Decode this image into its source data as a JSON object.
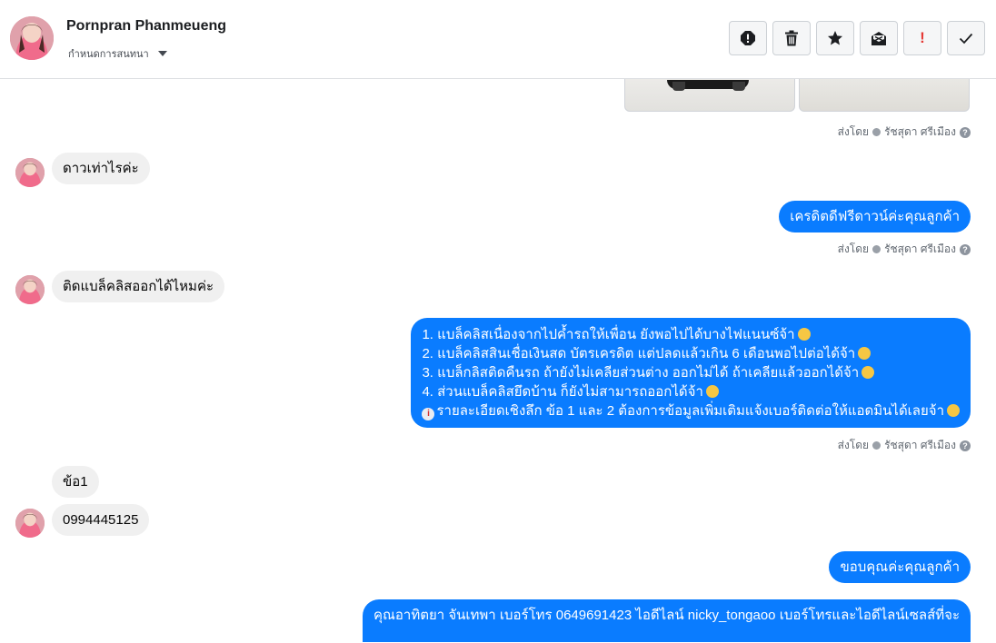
{
  "contact": {
    "name": "Pornpran Phanmeueng",
    "assign_label": "กำหนดการสนทนา"
  },
  "toolbar": {
    "buttons": [
      {
        "name": "report-icon"
      },
      {
        "name": "trash-icon"
      },
      {
        "name": "star-icon"
      },
      {
        "name": "mark-unread-icon"
      },
      {
        "name": "important-icon",
        "glyph": "!"
      },
      {
        "name": "check-icon"
      }
    ],
    "important_color": "#e53935"
  },
  "messages": {
    "sent_by_1": {
      "prefix": "ส่งโดย",
      "agent": "รัชสุดา ศรีเมือง",
      "help": "?"
    },
    "in_1": "ดาวเท่าไรค่ะ",
    "out_1": "เครดิตดีฟรีดาวน์ค่ะคุณลูกค้า",
    "sent_by_2": {
      "prefix": "ส่งโดย",
      "agent": "รัชสุดา ศรีเมือง",
      "help": "?"
    },
    "in_2": "ติดแบล็คลิสออกได้ไหมค่ะ",
    "out_2": {
      "lines": [
        "1. แบล็คลิสเนื่องจากไปค้ำรถให้เพื่อน ยังพอไปได้บางไฟแนนซ์จ้า",
        "2. แบล็คลิสสินเชื่อเงินสด บัตรเครดิต แต่ปลดแล้วเกิน 6 เดือนพอไปต่อได้จ้า",
        "3. แบล็กลิสติดคืนรถ ถ้ายังไม่เคลียส่วนต่าง ออกไม่ได้ ถ้าเคลียแล้วออกได้จ้า",
        "4. ส่วนแบล็คลิสยึดบ้าน ก็ยังไม่สามารถออกได้จ้า",
        "รายละเอียดเชิงลึก ข้อ 1 และ 2 ต้องการข้อมูลเพิ่มเติมแจ้งเบอร์ติดต่อให้แอดมินได้เลยจ้า"
      ],
      "info_glyph": "i"
    },
    "sent_by_3": {
      "prefix": "ส่งโดย",
      "agent": "รัชสุดา ศรีเมือง",
      "help": "?"
    },
    "in_3": "ข้อ1",
    "in_4": "0994445125",
    "out_3": "ขอบคุณค่ะคุณลูกค้า",
    "out_4": "คุณอาทิตยา จันเทพา     เบอร์โทร 0649691423  ไอดีไลน์ nicky_tongaoo   เบอร์โทรและไอดีไลน์เซลส์ที่จะ"
  },
  "colors": {
    "outgoing_bubble": "#0a7cff",
    "incoming_bubble": "#f0f0f0"
  }
}
